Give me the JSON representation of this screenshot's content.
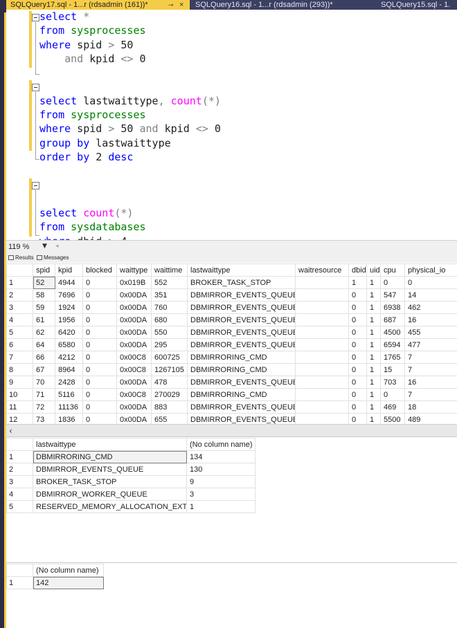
{
  "tabs": [
    {
      "label": "SQLQuery17.sql - 1...r (rdsadmin (161))*",
      "pin": "⊸",
      "close": "×"
    },
    {
      "label": "SQLQuery16.sql - 1...r (rdsadmin (293))*"
    },
    {
      "label": "SQLQuery15.sql - 1."
    }
  ],
  "zoom": {
    "value": "119 %"
  },
  "result_tabs": {
    "results": "Results",
    "messages": "Messages"
  },
  "grid1": {
    "columns": [
      "spid",
      "kpid",
      "blocked",
      "waittype",
      "waittime",
      "lastwaittype",
      "waitresource",
      "dbid",
      "uid",
      "cpu",
      "physical_io"
    ],
    "rows": [
      [
        "1",
        "52",
        "4944",
        "0",
        "0x019B",
        "552",
        "BROKER_TASK_STOP",
        "",
        "1",
        "1",
        "0",
        "0"
      ],
      [
        "2",
        "58",
        "7696",
        "0",
        "0x00DA",
        "351",
        "DBMIRROR_EVENTS_QUEUE",
        "",
        "0",
        "1",
        "547",
        "14"
      ],
      [
        "3",
        "59",
        "1924",
        "0",
        "0x00DA",
        "760",
        "DBMIRROR_EVENTS_QUEUE",
        "",
        "0",
        "1",
        "6938",
        "462"
      ],
      [
        "4",
        "61",
        "1956",
        "0",
        "0x00DA",
        "680",
        "DBMIRROR_EVENTS_QUEUE",
        "",
        "0",
        "1",
        "687",
        "16"
      ],
      [
        "5",
        "62",
        "6420",
        "0",
        "0x00DA",
        "550",
        "DBMIRROR_EVENTS_QUEUE",
        "",
        "0",
        "1",
        "4500",
        "455"
      ],
      [
        "6",
        "64",
        "6580",
        "0",
        "0x00DA",
        "295",
        "DBMIRROR_EVENTS_QUEUE",
        "",
        "0",
        "1",
        "6594",
        "477"
      ],
      [
        "7",
        "66",
        "4212",
        "0",
        "0x00C8",
        "600725",
        "DBMIRRORING_CMD",
        "",
        "0",
        "1",
        "1765",
        "7"
      ],
      [
        "8",
        "67",
        "8964",
        "0",
        "0x00C8",
        "1267105",
        "DBMIRRORING_CMD",
        "",
        "0",
        "1",
        "15",
        "7"
      ],
      [
        "9",
        "70",
        "2428",
        "0",
        "0x00DA",
        "478",
        "DBMIRROR_EVENTS_QUEUE",
        "",
        "0",
        "1",
        "703",
        "16"
      ],
      [
        "10",
        "71",
        "5116",
        "0",
        "0x00C8",
        "270029",
        "DBMIRRORING_CMD",
        "",
        "0",
        "1",
        "0",
        "7"
      ],
      [
        "11",
        "72",
        "11136",
        "0",
        "0x00DA",
        "883",
        "DBMIRROR_EVENTS_QUEUE",
        "",
        "0",
        "1",
        "469",
        "18"
      ],
      [
        "12",
        "73",
        "1836",
        "0",
        "0x00DA",
        "655",
        "DBMIRROR_EVENTS_QUEUE",
        "",
        "0",
        "1",
        "5500",
        "489"
      ]
    ]
  },
  "grid2": {
    "columns": [
      "lastwaittype",
      "(No column name)"
    ],
    "rows": [
      [
        "1",
        "DBMIRRORING_CMD",
        "134"
      ],
      [
        "2",
        "DBMIRROR_EVENTS_QUEUE",
        "130"
      ],
      [
        "3",
        "BROKER_TASK_STOP",
        "9"
      ],
      [
        "4",
        "DBMIRROR_WORKER_QUEUE",
        "3"
      ],
      [
        "5",
        "RESERVED_MEMORY_ALLOCATION_EXT",
        "1"
      ]
    ]
  },
  "grid3": {
    "columns": [
      "(No column name)"
    ],
    "rows": [
      [
        "1",
        "142"
      ]
    ]
  },
  "colors": {
    "accent": "#f5cc47",
    "frame": "#2d2d44",
    "tabbar": "#3b3f62",
    "keyword": "#0000ff",
    "function": "#ff00ff",
    "table": "#008000",
    "string": "#ff0000"
  }
}
